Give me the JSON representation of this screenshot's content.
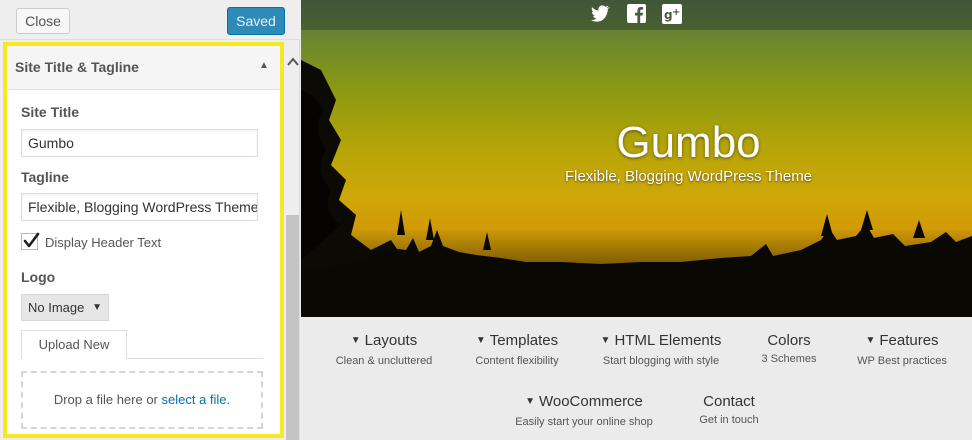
{
  "toolbar": {
    "close_label": "Close",
    "saved_label": "Saved"
  },
  "section": {
    "title": "Site Title & Tagline",
    "collapse_icon": "▲",
    "site_title_label": "Site Title",
    "site_title_value": "Gumbo",
    "tagline_label": "Tagline",
    "tagline_value": "Flexible, Blogging WordPress Theme",
    "display_header_text_label": "Display Header Text",
    "display_header_text_checked": true,
    "logo_label": "Logo",
    "logo_select_value": "No Image",
    "upload_tab_label": "Upload New",
    "dropzone_text": "Drop a file here or ",
    "dropzone_link": "select a file",
    "dropzone_end": "."
  },
  "scroll": {
    "up_icon": "chevron-up-icon"
  },
  "preview": {
    "social_icons": [
      "twitter-icon",
      "facebook-icon",
      "google-plus-icon"
    ],
    "site_title": "Gumbo",
    "site_tagline": "Flexible, Blogging WordPress Theme",
    "nav": [
      {
        "label": "Layouts",
        "sub": "Clean & uncluttered",
        "dropdown": true
      },
      {
        "label": "Templates",
        "sub": "Content flexibility",
        "dropdown": true
      },
      {
        "label": "HTML Elements",
        "sub": "Start blogging with style",
        "dropdown": true
      },
      {
        "label": "Colors",
        "sub": "3 Schemes",
        "dropdown": false
      },
      {
        "label": "Features",
        "sub": "WP Best practices",
        "dropdown": true
      },
      {
        "label": "WooCommerce",
        "sub": "Easily start your online shop",
        "dropdown": true
      },
      {
        "label": "Contact",
        "sub": "Get in touch",
        "dropdown": false
      }
    ]
  },
  "colors": {
    "highlight": "#f4e922",
    "primary_button": "#2e8ab7",
    "link": "#0073aa"
  }
}
